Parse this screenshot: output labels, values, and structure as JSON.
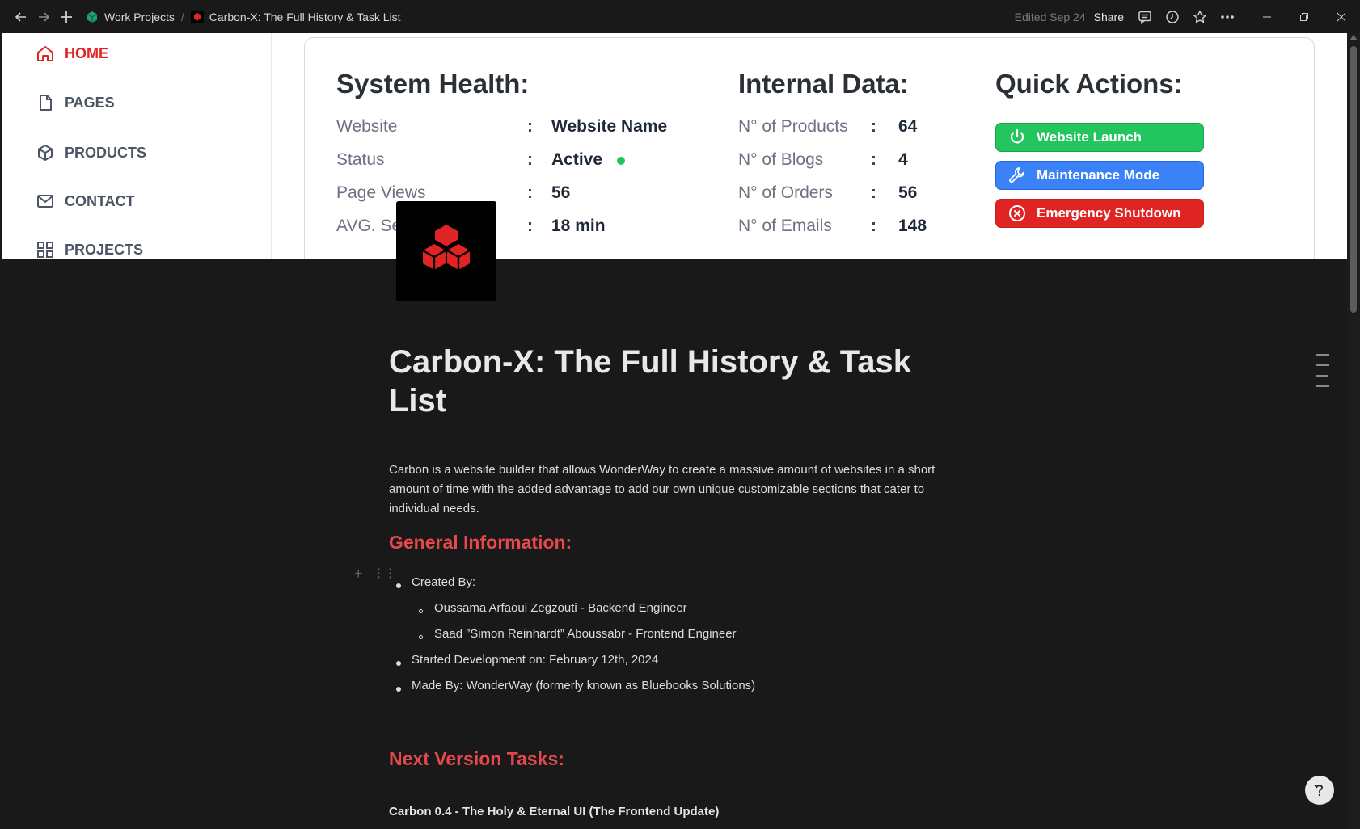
{
  "topbar": {
    "breadcrumb_workspace": "Work Projects",
    "breadcrumb_page": "Carbon-X: The Full History & Task List",
    "edited": "Edited Sep 24",
    "share": "Share"
  },
  "cover": {
    "nav": [
      "HOME",
      "PAGES",
      "PRODUCTS",
      "CONTACT",
      "PROJECTS"
    ],
    "system_health": {
      "heading": "System Health:",
      "rows": [
        {
          "label": "Website",
          "value": "Website Name"
        },
        {
          "label": "Status",
          "value": "Active"
        },
        {
          "label": "Page Views",
          "value": "56"
        },
        {
          "label": "AVG. Session",
          "value": "18 min"
        }
      ]
    },
    "internal_data": {
      "heading": "Internal Data:",
      "rows": [
        {
          "label": "N° of Products",
          "value": "64"
        },
        {
          "label": "N° of Blogs",
          "value": "4"
        },
        {
          "label": "N° of Orders",
          "value": "56"
        },
        {
          "label": "N° of Emails",
          "value": "148"
        }
      ]
    },
    "quick_actions": {
      "heading": "Quick Actions:",
      "buttons": [
        "Website Launch",
        "Maintenance Mode",
        "Emergency Shutdown"
      ]
    },
    "colon": ":"
  },
  "doc": {
    "title": "Carbon-X: The Full History & Task List",
    "intro": "Carbon is a website builder that allows WonderWay to create a massive amount of websites in a short amount of time with the added advantage to add our own unique customizable sections that cater to individual needs.",
    "general_heading": "General Information:",
    "created_by": "Created By:",
    "creators": [
      "Oussama Arfaoui Zegzouti - Backend Engineer",
      "Saad ”Simon Reinhardt” Aboussabr - Frontend Engineer"
    ],
    "started": "Started Development on:  February 12th, 2024",
    "made_by": "Made By: WonderWay (formerly known as Bluebooks Solutions)",
    "next_heading": "Next Version Tasks:",
    "version_title": "Carbon 0.4 -  The Holy & Eternal UI (The Frontend Update)"
  },
  "colors": {
    "accent_red": "#e5484d",
    "active_green": "#22c55e",
    "maintenance_blue": "#3b82f6",
    "shutdown_red": "#e02424"
  }
}
